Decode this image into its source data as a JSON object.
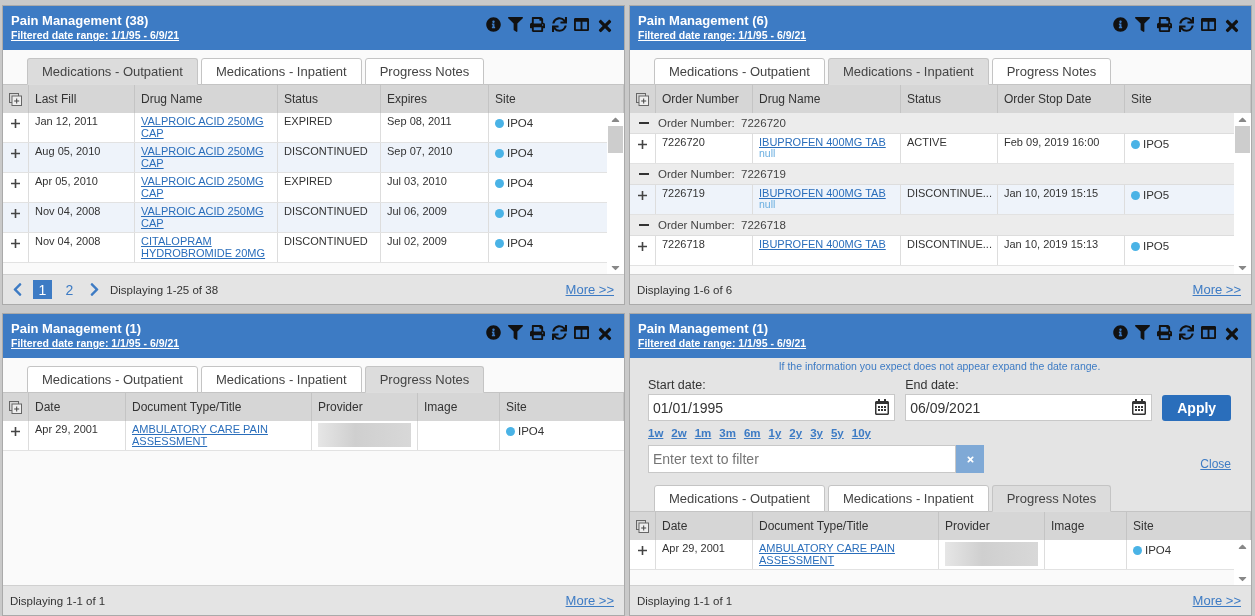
{
  "panels": [
    {
      "title": "Pain Management (38)",
      "date_range": "Filtered date range: 1/1/95 - 6/9/21",
      "scrollable": true,
      "tabs": [
        {
          "label": "Medications - Outpatient",
          "selected": true
        },
        {
          "label": "Medications - Inpatient",
          "selected": false
        },
        {
          "label": "Progress Notes",
          "selected": false
        }
      ],
      "columns": [
        "Last Fill",
        "Drug Name",
        "Status",
        "Expires",
        "Site"
      ],
      "rows": [
        {
          "kind": "data",
          "striped": false,
          "cells": [
            {
              "kind": "text",
              "text": "Jan 12, 2011"
            },
            {
              "kind": "link",
              "text": "VALPROIC ACID 250MG CAP"
            },
            {
              "kind": "text",
              "text": "EXPIRED"
            },
            {
              "kind": "text",
              "text": "Sep 08, 2011"
            },
            {
              "kind": "site",
              "text": "IPO4"
            }
          ]
        },
        {
          "kind": "data",
          "striped": true,
          "cells": [
            {
              "kind": "text",
              "text": "Aug 05, 2010"
            },
            {
              "kind": "link",
              "text": "VALPROIC ACID 250MG CAP"
            },
            {
              "kind": "text",
              "text": "DISCONTINUED"
            },
            {
              "kind": "text",
              "text": "Sep 07, 2010"
            },
            {
              "kind": "site",
              "text": "IPO4"
            }
          ]
        },
        {
          "kind": "data",
          "striped": false,
          "cells": [
            {
              "kind": "text",
              "text": "Apr 05, 2010"
            },
            {
              "kind": "link",
              "text": "VALPROIC ACID 250MG CAP"
            },
            {
              "kind": "text",
              "text": "EXPIRED"
            },
            {
              "kind": "text",
              "text": "Jul 03, 2010"
            },
            {
              "kind": "site",
              "text": "IPO4"
            }
          ]
        },
        {
          "kind": "data",
          "striped": true,
          "cells": [
            {
              "kind": "text",
              "text": "Nov 04, 2008"
            },
            {
              "kind": "link",
              "text": "VALPROIC ACID 250MG CAP"
            },
            {
              "kind": "text",
              "text": "DISCONTINUED"
            },
            {
              "kind": "text",
              "text": "Jul 06, 2009"
            },
            {
              "kind": "site",
              "text": "IPO4"
            }
          ]
        },
        {
          "kind": "data",
          "striped": false,
          "cells": [
            {
              "kind": "text",
              "text": "Nov 04, 2008"
            },
            {
              "kind": "link",
              "text": "CITALOPRAM HYDROBROMIDE 20MG"
            },
            {
              "kind": "text",
              "text": "DISCONTINUED"
            },
            {
              "kind": "text",
              "text": "Jul 02, 2009"
            },
            {
              "kind": "site",
              "text": "IPO4"
            }
          ]
        }
      ],
      "pager": {
        "pages": [
          {
            "label": "1",
            "selected": true
          },
          {
            "label": "2",
            "selected": false
          }
        ]
      },
      "display": "Displaying 1-25 of 38",
      "more": "More >>"
    },
    {
      "title": "Pain Management (6)",
      "date_range": "Filtered date range: 1/1/95 - 6/9/21",
      "scrollable": true,
      "tabs": [
        {
          "label": "Medications - Outpatient",
          "selected": false
        },
        {
          "label": "Medications - Inpatient",
          "selected": true
        },
        {
          "label": "Progress Notes",
          "selected": false
        }
      ],
      "columns": [
        "Order Number",
        "Drug Name",
        "Status",
        "Order Stop Date",
        "Site"
      ],
      "rows": [
        {
          "kind": "group",
          "label": "Order Number:",
          "value": "7226720"
        },
        {
          "kind": "data",
          "striped": false,
          "cells": [
            {
              "kind": "text",
              "text": "7226720"
            },
            {
              "kind": "link",
              "text": "IBUPROFEN 400MG TAB",
              "sub": "null"
            },
            {
              "kind": "text",
              "text": "ACTIVE"
            },
            {
              "kind": "text",
              "text": "Feb 09, 2019 16:00"
            },
            {
              "kind": "site",
              "text": "IPO5"
            }
          ]
        },
        {
          "kind": "group",
          "label": "Order Number:",
          "value": "7226719"
        },
        {
          "kind": "data",
          "striped": true,
          "cells": [
            {
              "kind": "text",
              "text": "7226719"
            },
            {
              "kind": "link",
              "text": "IBUPROFEN 400MG TAB",
              "sub": "null"
            },
            {
              "kind": "text",
              "text": "DISCONTINUE..."
            },
            {
              "kind": "text",
              "text": "Jan 10, 2019 15:15"
            },
            {
              "kind": "site",
              "text": "IPO5"
            }
          ]
        },
        {
          "kind": "group",
          "label": "Order Number:",
          "value": "7226718"
        },
        {
          "kind": "data",
          "striped": false,
          "cells": [
            {
              "kind": "text",
              "text": "7226718"
            },
            {
              "kind": "link",
              "text": "IBUPROFEN 400MG TAB"
            },
            {
              "kind": "text",
              "text": "DISCONTINUE..."
            },
            {
              "kind": "text",
              "text": "Jan 10, 2019 15:13"
            },
            {
              "kind": "site",
              "text": "IPO5"
            }
          ]
        }
      ],
      "display": "Displaying 1-6 of 6",
      "more": "More >>"
    },
    {
      "title": "Pain Management (1)",
      "date_range": "Filtered date range: 1/1/95 - 6/9/21",
      "tabs": [
        {
          "label": "Medications - Outpatient",
          "selected": false
        },
        {
          "label": "Medications - Inpatient",
          "selected": false
        },
        {
          "label": "Progress Notes",
          "selected": true
        }
      ],
      "columns": [
        "Date",
        "Document Type/Title",
        "Provider",
        "Image",
        "Site"
      ],
      "rows": [
        {
          "kind": "data",
          "striped": false,
          "cells": [
            {
              "kind": "text",
              "text": "Apr 29, 2001"
            },
            {
              "kind": "link",
              "text": "AMBULATORY CARE PAIN ASSESSMENT"
            },
            {
              "kind": "redacted"
            },
            {
              "kind": "empty"
            },
            {
              "kind": "site",
              "text": "IPO4"
            }
          ]
        }
      ],
      "display": "Displaying 1-1 of 1",
      "more": "More >>"
    },
    {
      "title": "Pain Management (1)",
      "date_range": "Filtered date range: 1/1/95 - 6/9/21",
      "scrollable": true,
      "filter": {
        "notice": "If the information you expect does not appear expand the date range.",
        "start_label": "Start date:",
        "start_value": "01/01/1995",
        "end_label": "End date:",
        "end_value": "06/09/2021",
        "apply": "Apply",
        "ranges": [
          "1w",
          "2w",
          "1m",
          "3m",
          "6m",
          "1y",
          "2y",
          "3y",
          "5y",
          "10y"
        ],
        "placeholder": "Enter text to filter",
        "close": "Close"
      },
      "tabs": [
        {
          "label": "Medications - Outpatient",
          "selected": false
        },
        {
          "label": "Medications - Inpatient",
          "selected": false
        },
        {
          "label": "Progress Notes",
          "selected": true
        }
      ],
      "columns": [
        "Date",
        "Document Type/Title",
        "Provider",
        "Image",
        "Site"
      ],
      "rows": [
        {
          "kind": "data",
          "striped": false,
          "cells": [
            {
              "kind": "text",
              "text": "Apr 29, 2001"
            },
            {
              "kind": "link",
              "text": "AMBULATORY CARE PAIN ASSESSMENT"
            },
            {
              "kind": "redacted"
            },
            {
              "kind": "empty"
            },
            {
              "kind": "site",
              "text": "IPO4"
            }
          ]
        }
      ],
      "display": "Displaying 1-1 of 1",
      "more": "More >>"
    }
  ]
}
